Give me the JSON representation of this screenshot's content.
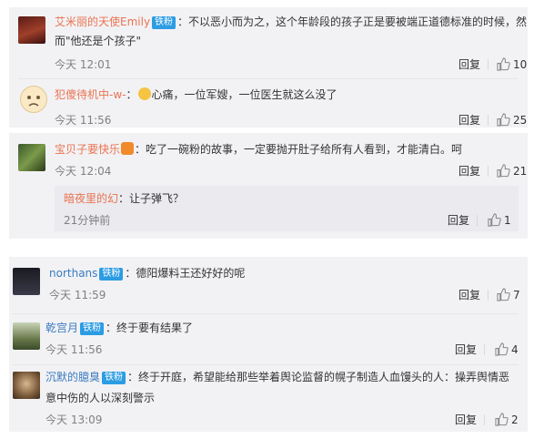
{
  "colors": {
    "username": "#eb7350",
    "badge": "#2c9ce3",
    "card_bg": "#f2f2f5",
    "time": "#808080"
  },
  "reply_label": "回复",
  "badge_label": "铁粉",
  "card1": {
    "c1": {
      "user": "艾米丽的天使Emily",
      "text1": "：不以恶小而为之，这个年龄段的孩子正是要被端正道德标准的时候，然",
      "text2": "而\"他还是个孩子\"",
      "time": "今天 12:01",
      "likes": "10"
    },
    "c2": {
      "user": "犯傻待机中-w-",
      "text": "：",
      "text_b": "心痛，一位军嫂，一位医生就这么没了",
      "time": "今天 11:56",
      "likes": "25"
    }
  },
  "card2": {
    "c1": {
      "user": "宝贝子要快乐",
      "text": "：吃了一碗粉的故事，一定要抛开肚子给所有人看到，才能清白。呵",
      "time": "今天 12:04",
      "likes": "21"
    },
    "sub": {
      "user": "暗夜里的幻",
      "text": "：让子弹飞？",
      "time": "21分钟前",
      "likes": "1"
    }
  },
  "card3": {
    "c1": {
      "user": "northans",
      "text": "：德阳爆料王还好好的呢",
      "time": "今天 11:59",
      "likes": "7"
    },
    "c2": {
      "user": "乾宫月",
      "text": "：终于要有结果了",
      "time": "今天 11:56",
      "likes": "4"
    },
    "c3": {
      "user": "沉默的臆臭",
      "text1": "：终于开庭，希望能给那些举着舆论监督的幌子制造人血馒头的人：操弄舆情恶",
      "text2": "意中伤的人以深刻警示",
      "time": "今天 13:09",
      "likes": "2"
    }
  }
}
